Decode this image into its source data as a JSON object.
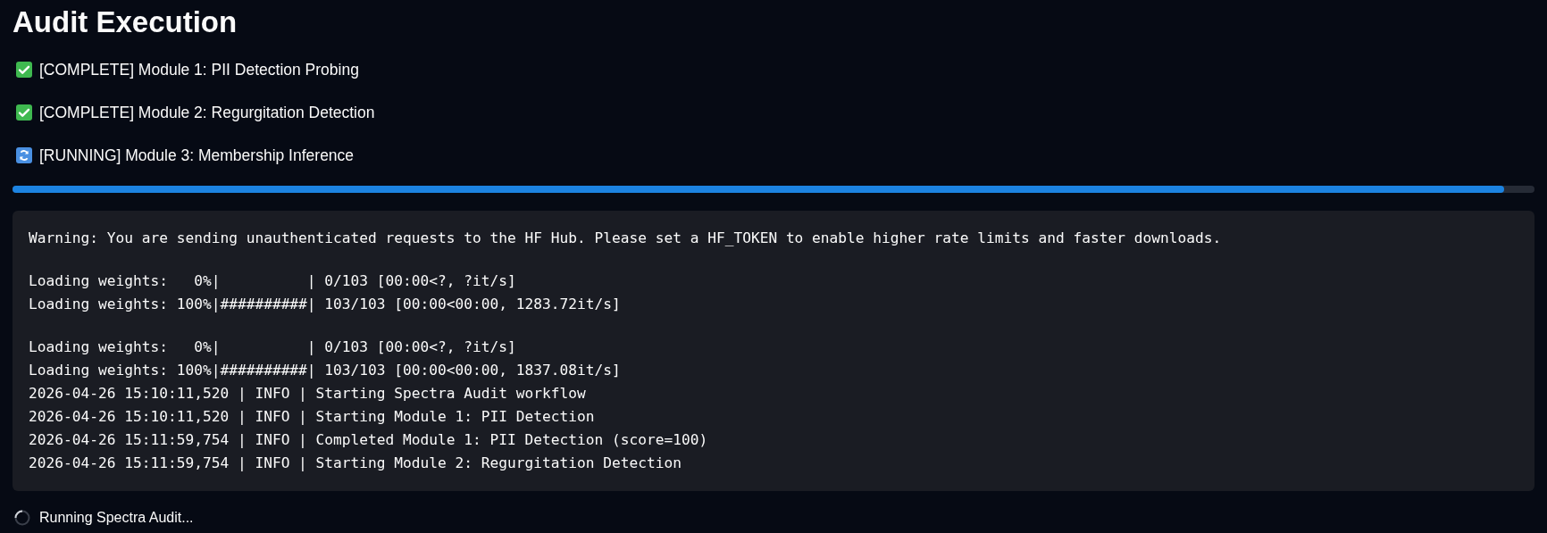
{
  "title": "Audit Execution",
  "modules": [
    {
      "kind": "complete",
      "text": "[COMPLETE] Module 1: PII Detection Probing"
    },
    {
      "kind": "complete",
      "text": "[COMPLETE] Module 2: Regurgitation Detection"
    },
    {
      "kind": "running",
      "text": "[RUNNING] Module 3: Membership Inference"
    }
  ],
  "progress": {
    "level": 0.98
  },
  "log": {
    "blocks": [
      [
        "Warning: You are sending unauthenticated requests to the HF Hub. Please set a HF_TOKEN to enable higher rate limits and faster downloads."
      ],
      [
        "Loading weights:   0%|          | 0/103 [00:00<?, ?it/s]",
        "Loading weights: 100%|##########| 103/103 [00:00<00:00, 1283.72it/s]"
      ],
      [
        "Loading weights:   0%|          | 0/103 [00:00<?, ?it/s]",
        "Loading weights: 100%|##########| 103/103 [00:00<00:00, 1837.08it/s]",
        "2026-04-26 15:10:11,520 | INFO | Starting Spectra Audit workflow",
        "2026-04-26 15:10:11,520 | INFO | Starting Module 1: PII Detection",
        "2026-04-26 15:11:59,754 | INFO | Completed Module 1: PII Detection (score=100)",
        "2026-04-26 15:11:59,754 | INFO | Starting Module 2: Regurgitation Detection"
      ]
    ]
  },
  "spinner": {
    "text": "Running Spectra Audit..."
  }
}
